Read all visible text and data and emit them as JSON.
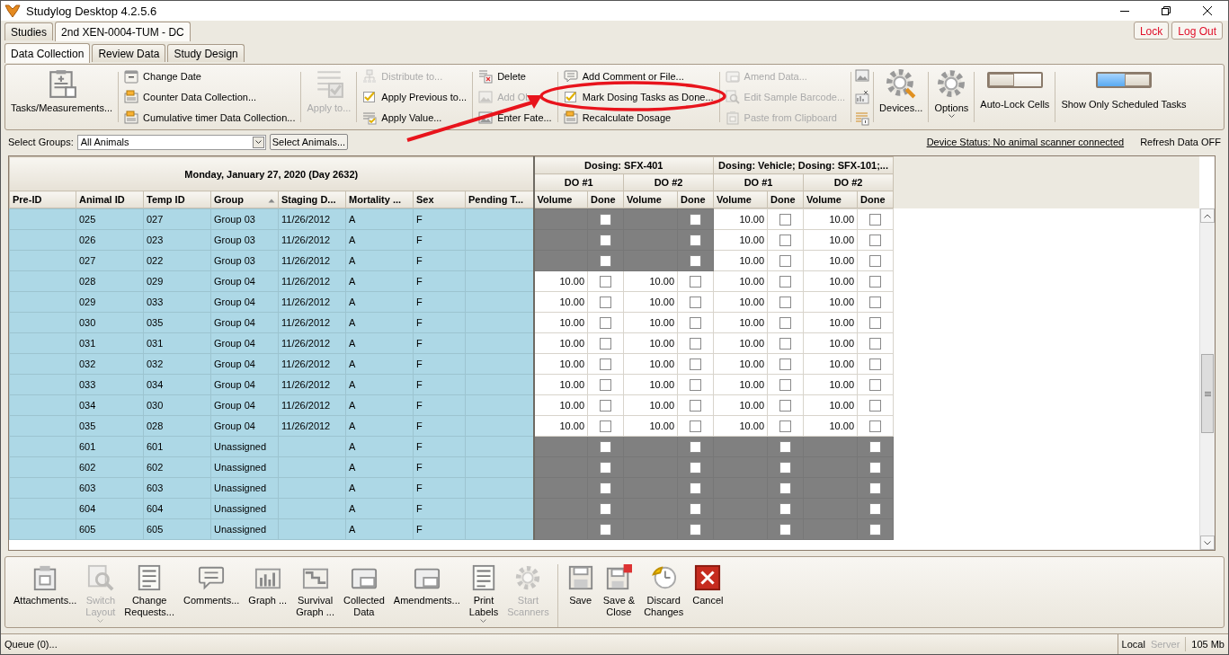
{
  "window": {
    "title": "Studylog Desktop 4.2.5.6"
  },
  "doc_tabs": [
    {
      "label": "Studies",
      "selected": false
    },
    {
      "label": "2nd XEN-0004-TUM - DC",
      "selected": true
    }
  ],
  "session_buttons": [
    "Lock",
    "Log Out"
  ],
  "tabs": [
    {
      "label": "Data Collection",
      "selected": true
    },
    {
      "label": "Review Data",
      "selected": false
    },
    {
      "label": "Study Design",
      "selected": false
    }
  ],
  "ribbon": [
    {
      "kind": "large",
      "items": [
        {
          "label": "Tasks/Measurements...",
          "disabled": false
        }
      ]
    },
    {
      "kind": "list",
      "items": [
        {
          "label": "Change Date",
          "disabled": false
        },
        {
          "label": "Counter Data Collection...",
          "disabled": false
        },
        {
          "label": "Cumulative timer Data Collection...",
          "disabled": false
        }
      ]
    },
    {
      "kind": "large",
      "items": [
        {
          "label": "Apply to...",
          "disabled": true
        }
      ]
    },
    {
      "kind": "list",
      "items": [
        {
          "label": "Distribute to...",
          "disabled": true
        },
        {
          "label": "Apply Previous to...",
          "disabled": false
        },
        {
          "label": "Apply Value...",
          "disabled": false
        }
      ]
    },
    {
      "kind": "list",
      "items": [
        {
          "label": "Delete",
          "disabled": false
        },
        {
          "label": "Add Ob",
          "disabled": true
        },
        {
          "label": "Enter Fate...",
          "disabled": false
        }
      ]
    },
    {
      "kind": "list",
      "items": [
        {
          "label": "Add Comment or File...",
          "disabled": false
        },
        {
          "label": "Mark Dosing Tasks as Done...",
          "disabled": false
        },
        {
          "label": "Recalculate Dosage",
          "disabled": false
        }
      ]
    },
    {
      "kind": "list",
      "items": [
        {
          "label": "Amend Data...",
          "disabled": true
        },
        {
          "label": "Edit Sample Barcode...",
          "disabled": true
        },
        {
          "label": "Paste from Clipboard",
          "disabled": true
        }
      ]
    },
    {
      "kind": "icons",
      "items": [
        {
          "disabled": false
        },
        {
          "disabled": false
        },
        {
          "disabled": false
        }
      ]
    },
    {
      "kind": "large",
      "items": [
        {
          "label": "Devices...",
          "disabled": false
        }
      ]
    },
    {
      "kind": "large",
      "items": [
        {
          "label": "Options",
          "disabled": false,
          "caret": true
        }
      ]
    },
    {
      "kind": "toggle",
      "label": "Auto-Lock Cells",
      "on": false
    },
    {
      "kind": "toggle",
      "label": "Show Only Scheduled Tasks",
      "on": true
    }
  ],
  "filter": {
    "label": "Select Groups:",
    "value": "All Animals",
    "button": "Select Animals...",
    "device_status": "Device Status: No animal scanner connected",
    "refresh": "Refresh Data OFF"
  },
  "grid": {
    "date_header": "Monday, January 27, 2020 (Day 2632)",
    "columns": [
      {
        "label": "Pre-ID",
        "sorted": false
      },
      {
        "label": "Animal ID",
        "sorted": false
      },
      {
        "label": "Temp ID",
        "sorted": false
      },
      {
        "label": "Group",
        "sorted": true
      },
      {
        "label": "Staging D...",
        "sorted": false
      },
      {
        "label": "Mortality ...",
        "sorted": false
      },
      {
        "label": "Sex",
        "sorted": false
      },
      {
        "label": "Pending T...",
        "sorted": false
      }
    ],
    "dosing_groups": [
      {
        "title": "Dosing: SFX-401",
        "doses": [
          {
            "label": "DO #1",
            "volume_label": "Volume",
            "done_label": "Done"
          },
          {
            "label": "DO #2",
            "volume_label": "Volume",
            "done_label": "Done"
          }
        ]
      },
      {
        "title": "Dosing: Vehicle; Dosing: SFX-101;...",
        "doses": [
          {
            "label": "DO #1",
            "volume_label": "Volume",
            "done_label": "Done"
          },
          {
            "label": "DO #2",
            "volume_label": "Volume",
            "done_label": "Done"
          }
        ]
      }
    ],
    "rows": [
      {
        "animal_id": "025",
        "temp_id": "027",
        "group": "Group 03",
        "staging_date": "11/26/2012",
        "mortality": "A",
        "sex": "F",
        "doses": [
          {
            "scheduled": false,
            "done": false
          },
          {
            "scheduled": false,
            "done": false
          },
          {
            "scheduled": true,
            "volume": "10.00",
            "done": false
          },
          {
            "scheduled": true,
            "volume": "10.00",
            "done": false
          }
        ]
      },
      {
        "animal_id": "026",
        "temp_id": "023",
        "group": "Group 03",
        "staging_date": "11/26/2012",
        "mortality": "A",
        "sex": "F",
        "doses": [
          {
            "scheduled": false,
            "done": false
          },
          {
            "scheduled": false,
            "done": false
          },
          {
            "scheduled": true,
            "volume": "10.00",
            "done": false
          },
          {
            "scheduled": true,
            "volume": "10.00",
            "done": false
          }
        ]
      },
      {
        "animal_id": "027",
        "temp_id": "022",
        "group": "Group 03",
        "staging_date": "11/26/2012",
        "mortality": "A",
        "sex": "F",
        "doses": [
          {
            "scheduled": false,
            "done": false
          },
          {
            "scheduled": false,
            "done": false
          },
          {
            "scheduled": true,
            "volume": "10.00",
            "done": false
          },
          {
            "scheduled": true,
            "volume": "10.00",
            "done": false
          }
        ]
      },
      {
        "animal_id": "028",
        "temp_id": "029",
        "group": "Group 04",
        "staging_date": "11/26/2012",
        "mortality": "A",
        "sex": "F",
        "doses": [
          {
            "scheduled": true,
            "volume": "10.00",
            "done": false
          },
          {
            "scheduled": true,
            "volume": "10.00",
            "done": false
          },
          {
            "scheduled": true,
            "volume": "10.00",
            "done": false
          },
          {
            "scheduled": true,
            "volume": "10.00",
            "done": false
          }
        ]
      },
      {
        "animal_id": "029",
        "temp_id": "033",
        "group": "Group 04",
        "staging_date": "11/26/2012",
        "mortality": "A",
        "sex": "F",
        "doses": [
          {
            "scheduled": true,
            "volume": "10.00",
            "done": false
          },
          {
            "scheduled": true,
            "volume": "10.00",
            "done": false
          },
          {
            "scheduled": true,
            "volume": "10.00",
            "done": false
          },
          {
            "scheduled": true,
            "volume": "10.00",
            "done": false
          }
        ]
      },
      {
        "animal_id": "030",
        "temp_id": "035",
        "group": "Group 04",
        "staging_date": "11/26/2012",
        "mortality": "A",
        "sex": "F",
        "doses": [
          {
            "scheduled": true,
            "volume": "10.00",
            "done": false
          },
          {
            "scheduled": true,
            "volume": "10.00",
            "done": false
          },
          {
            "scheduled": true,
            "volume": "10.00",
            "done": false
          },
          {
            "scheduled": true,
            "volume": "10.00",
            "done": false
          }
        ]
      },
      {
        "animal_id": "031",
        "temp_id": "031",
        "group": "Group 04",
        "staging_date": "11/26/2012",
        "mortality": "A",
        "sex": "F",
        "doses": [
          {
            "scheduled": true,
            "volume": "10.00",
            "done": false
          },
          {
            "scheduled": true,
            "volume": "10.00",
            "done": false
          },
          {
            "scheduled": true,
            "volume": "10.00",
            "done": false
          },
          {
            "scheduled": true,
            "volume": "10.00",
            "done": false
          }
        ]
      },
      {
        "animal_id": "032",
        "temp_id": "032",
        "group": "Group 04",
        "staging_date": "11/26/2012",
        "mortality": "A",
        "sex": "F",
        "doses": [
          {
            "scheduled": true,
            "volume": "10.00",
            "done": false
          },
          {
            "scheduled": true,
            "volume": "10.00",
            "done": false
          },
          {
            "scheduled": true,
            "volume": "10.00",
            "done": false
          },
          {
            "scheduled": true,
            "volume": "10.00",
            "done": false
          }
        ]
      },
      {
        "animal_id": "033",
        "temp_id": "034",
        "group": "Group 04",
        "staging_date": "11/26/2012",
        "mortality": "A",
        "sex": "F",
        "doses": [
          {
            "scheduled": true,
            "volume": "10.00",
            "done": false
          },
          {
            "scheduled": true,
            "volume": "10.00",
            "done": false
          },
          {
            "scheduled": true,
            "volume": "10.00",
            "done": false
          },
          {
            "scheduled": true,
            "volume": "10.00",
            "done": false
          }
        ]
      },
      {
        "animal_id": "034",
        "temp_id": "030",
        "group": "Group 04",
        "staging_date": "11/26/2012",
        "mortality": "A",
        "sex": "F",
        "doses": [
          {
            "scheduled": true,
            "volume": "10.00",
            "done": false
          },
          {
            "scheduled": true,
            "volume": "10.00",
            "done": false
          },
          {
            "scheduled": true,
            "volume": "10.00",
            "done": false
          },
          {
            "scheduled": true,
            "volume": "10.00",
            "done": false
          }
        ]
      },
      {
        "animal_id": "035",
        "temp_id": "028",
        "group": "Group 04",
        "staging_date": "11/26/2012",
        "mortality": "A",
        "sex": "F",
        "doses": [
          {
            "scheduled": true,
            "volume": "10.00",
            "done": false
          },
          {
            "scheduled": true,
            "volume": "10.00",
            "done": false
          },
          {
            "scheduled": true,
            "volume": "10.00",
            "done": false
          },
          {
            "scheduled": true,
            "volume": "10.00",
            "done": false
          }
        ]
      },
      {
        "animal_id": "601",
        "temp_id": "601",
        "group": "Unassigned",
        "mortality": "A",
        "sex": "F",
        "doses": [
          {
            "scheduled": false,
            "done": false
          },
          {
            "scheduled": false,
            "done": false
          },
          {
            "scheduled": false,
            "done": false
          },
          {
            "scheduled": false,
            "done": false
          }
        ]
      },
      {
        "animal_id": "602",
        "temp_id": "602",
        "group": "Unassigned",
        "mortality": "A",
        "sex": "F",
        "doses": [
          {
            "scheduled": false,
            "done": false
          },
          {
            "scheduled": false,
            "done": false
          },
          {
            "scheduled": false,
            "done": false
          },
          {
            "scheduled": false,
            "done": false
          }
        ]
      },
      {
        "animal_id": "603",
        "temp_id": "603",
        "group": "Unassigned",
        "mortality": "A",
        "sex": "F",
        "doses": [
          {
            "scheduled": false,
            "done": false
          },
          {
            "scheduled": false,
            "done": false
          },
          {
            "scheduled": false,
            "done": false
          },
          {
            "scheduled": false,
            "done": false
          }
        ]
      },
      {
        "animal_id": "604",
        "temp_id": "604",
        "group": "Unassigned",
        "mortality": "A",
        "sex": "F",
        "doses": [
          {
            "scheduled": false,
            "done": false
          },
          {
            "scheduled": false,
            "done": false
          },
          {
            "scheduled": false,
            "done": false
          },
          {
            "scheduled": false,
            "done": false
          }
        ]
      },
      {
        "animal_id": "605",
        "temp_id": "605",
        "group": "Unassigned",
        "mortality": "A",
        "sex": "F",
        "doses": [
          {
            "scheduled": false,
            "done": false
          },
          {
            "scheduled": false,
            "done": false
          },
          {
            "scheduled": false,
            "done": false
          },
          {
            "scheduled": false,
            "done": false
          }
        ]
      }
    ]
  },
  "bottom_bar": [
    {
      "label": "Attachments...",
      "disabled": false
    },
    {
      "label": "Switch\nLayout",
      "disabled": true,
      "caret": true
    },
    {
      "label": "Change\nRequests...",
      "disabled": false
    },
    {
      "label": "Comments...",
      "disabled": false
    },
    {
      "label": "Graph ...",
      "disabled": false
    },
    {
      "label": "Survival\nGraph ...",
      "disabled": false
    },
    {
      "label": "Collected\nData",
      "disabled": false
    },
    {
      "label": "Amendments...",
      "disabled": false
    },
    {
      "label": "Print\nLabels",
      "disabled": false,
      "caret": true
    },
    {
      "label": "Start\nScanners",
      "disabled": true
    },
    {
      "label": "Save",
      "disabled": false,
      "separator": true
    },
    {
      "label": "Save &\nClose",
      "disabled": false
    },
    {
      "label": "Discard\nChanges",
      "disabled": false
    },
    {
      "label": "Cancel",
      "disabled": false
    }
  ],
  "status_bar": {
    "queue": "Queue (0)...",
    "modes": [
      {
        "label": "Local",
        "active": true
      },
      {
        "label": "Server",
        "active": false
      }
    ],
    "memory": "105 Mb"
  }
}
